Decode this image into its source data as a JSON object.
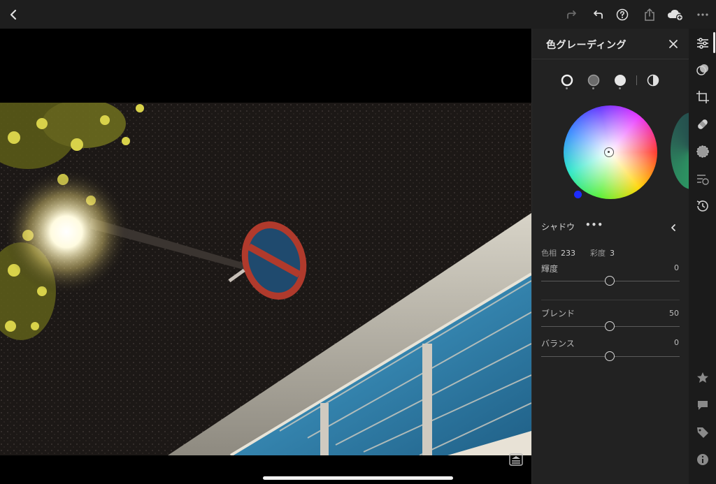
{
  "top_bar": {
    "icons": [
      "back-icon",
      "redo-icon",
      "undo-icon",
      "help-icon",
      "share-icon",
      "cloud-sync-icon",
      "more-icon"
    ]
  },
  "panel": {
    "title": "色グレーディング",
    "modes": [
      "shadows",
      "midtones",
      "highlights",
      "global"
    ],
    "wheel": {
      "hue": 233,
      "saturation": 3
    },
    "section": {
      "label": "シャドウ",
      "more": "•••"
    },
    "meta": {
      "hue_label": "色相",
      "hue_value": "233",
      "saturation_label": "彩度",
      "saturation_value": "3"
    },
    "sliders": [
      {
        "label": "輝度",
        "value": "0",
        "level": 0.5
      },
      {
        "label": "ブレンド",
        "value": "50",
        "level": 0.5
      },
      {
        "label": "バランス",
        "value": "0",
        "level": 0.5
      }
    ]
  },
  "toolbar": {
    "top_tools": [
      "edit-sliders-icon",
      "presets-icon",
      "crop-icon",
      "healing-icon",
      "masking-icon",
      "versions-icon",
      "history-icon"
    ],
    "bottom_tools": [
      "rating-star-icon",
      "comment-icon",
      "tag-icon",
      "info-icon"
    ]
  },
  "colors": {
    "background": "#000000",
    "panel": "#222222",
    "topbar": "#1e1e1e",
    "accent_handle": "#1d2cff"
  }
}
